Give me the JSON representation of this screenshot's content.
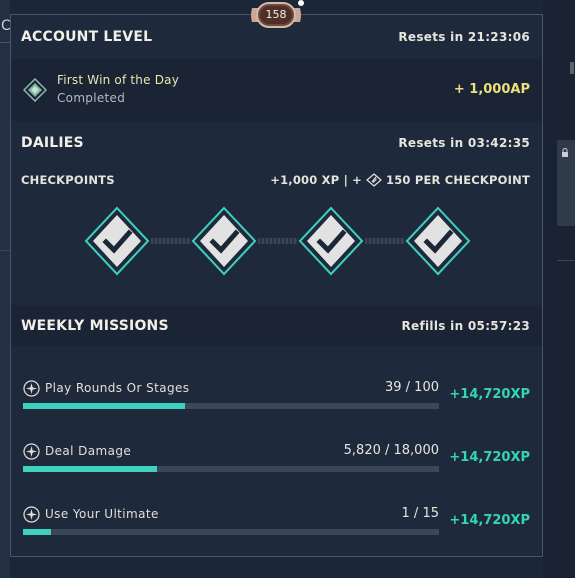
{
  "window": {
    "left_edge_letter": "C"
  },
  "badge": {
    "level": "158"
  },
  "account_level": {
    "title": "ACCOUNT LEVEL",
    "resets": "Resets in 21:23:06",
    "item": {
      "icon": "diamond-icon",
      "title": "First Win of the Day",
      "status": "Completed",
      "reward": "+ 1,000AP"
    }
  },
  "dailies": {
    "title": "DAILIES",
    "resets": "Resets in 03:42:35",
    "checkpoints_label": "CHECKPOINTS",
    "reward_xp": "+1,000 XP | +",
    "reward_suffix": "150 PER CHECKPOINT",
    "reward_icon": "radianite-point-icon",
    "checkpoints": [
      {
        "completed": true
      },
      {
        "completed": true
      },
      {
        "completed": true
      },
      {
        "completed": true
      }
    ]
  },
  "weekly": {
    "title": "WEEKLY MISSIONS",
    "refills": "Refills in 05:57:23",
    "missions": [
      {
        "title": "Play Rounds Or Stages",
        "count": "39 / 100",
        "progress": 0.39,
        "xp": "+14,720XP"
      },
      {
        "title": "Deal Damage",
        "count": "5,820 / 18,000",
        "progress": 0.323,
        "xp": "+14,720XP"
      },
      {
        "title": "Use Your Ultimate",
        "count": "1 / 15",
        "progress": 0.067,
        "xp": "+14,720XP"
      }
    ]
  },
  "colors": {
    "accent_teal": "#3fd1bf",
    "xp_green": "#33d6b1",
    "gold": "#ecdf7d",
    "panel_bg": "#1e2a3c"
  }
}
